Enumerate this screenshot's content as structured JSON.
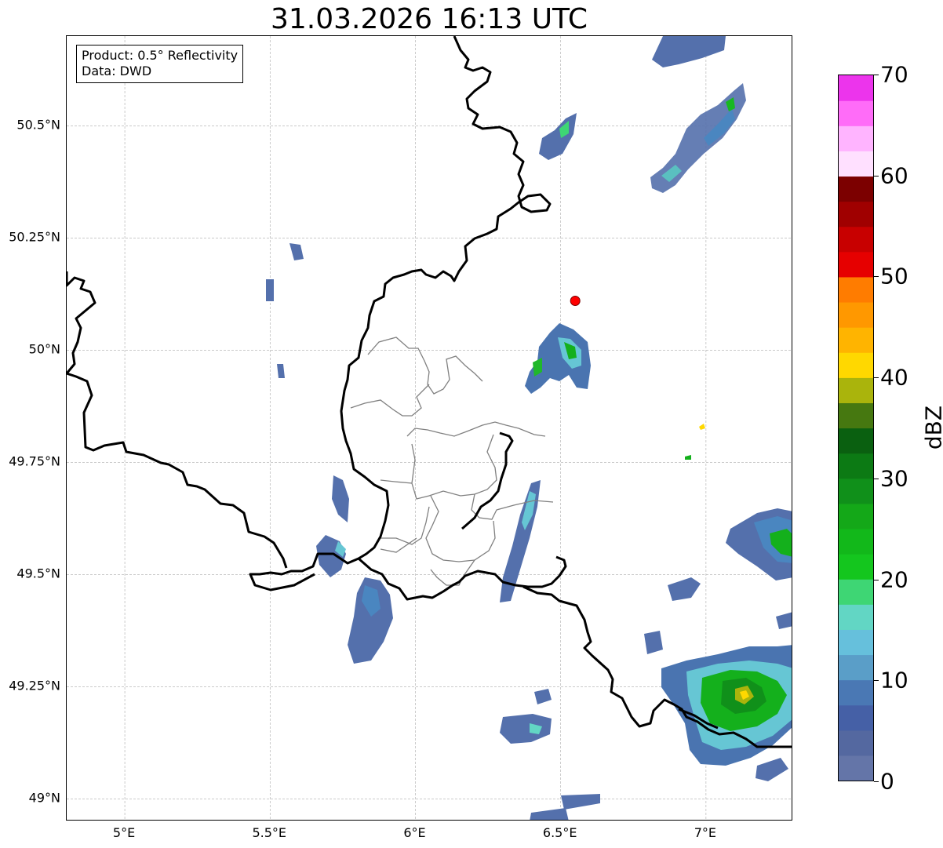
{
  "title": "31.03.2026 16:13 UTC",
  "info_box": {
    "product": "Product: 0.5° Reflectivity",
    "source": "Data: DWD"
  },
  "map": {
    "lon_range": [
      4.8,
      7.3
    ],
    "lat_range": [
      48.95,
      50.7
    ],
    "x_ticks": [
      {
        "lon": 5.0,
        "label": "5°E"
      },
      {
        "lon": 5.5,
        "label": "5.5°E"
      },
      {
        "lon": 6.0,
        "label": "6°E"
      },
      {
        "lon": 6.5,
        "label": "6.5°E"
      },
      {
        "lon": 7.0,
        "label": "7°E"
      }
    ],
    "y_ticks": [
      {
        "lat": 50.5,
        "label": "50.5°N"
      },
      {
        "lat": 50.25,
        "label": "50.25°N"
      },
      {
        "lat": 50.0,
        "label": "50°N"
      },
      {
        "lat": 49.75,
        "label": "49.75°N"
      },
      {
        "lat": 49.5,
        "label": "49.5°N"
      },
      {
        "lat": 49.25,
        "label": "49.25°N"
      },
      {
        "lat": 49.0,
        "label": "49°N"
      }
    ],
    "radar_site": {
      "lon": 6.55,
      "lat": 50.11,
      "color": "#ff0000"
    },
    "country_border_color": "#000000",
    "district_border_color": "#808080"
  },
  "colorbar": {
    "label": "dBZ",
    "min": 0,
    "max": 70,
    "ticks": [
      {
        "value": 0,
        "label": "0"
      },
      {
        "value": 10,
        "label": "10"
      },
      {
        "value": 20,
        "label": "20"
      },
      {
        "value": 30,
        "label": "30"
      },
      {
        "value": 40,
        "label": "40"
      },
      {
        "value": 50,
        "label": "50"
      },
      {
        "value": 60,
        "label": "60"
      },
      {
        "value": 70,
        "label": "70"
      }
    ],
    "colors": [
      "#6475a8",
      "#5468a0",
      "#4560a6",
      "#4a78b4",
      "#5a9ec8",
      "#66c0dc",
      "#62d6c4",
      "#3ed674",
      "#14c61e",
      "#12b81a",
      "#14a818",
      "#10901a",
      "#0c7a14",
      "#0a6010",
      "#467810",
      "#aab40c",
      "#ffd800",
      "#ffb400",
      "#ff9800",
      "#ff7c00",
      "#e60000",
      "#c80000",
      "#a00000",
      "#7c0000",
      "#ffe0ff",
      "#ffb4ff",
      "#ff6cf8",
      "#ec34ec"
    ]
  }
}
